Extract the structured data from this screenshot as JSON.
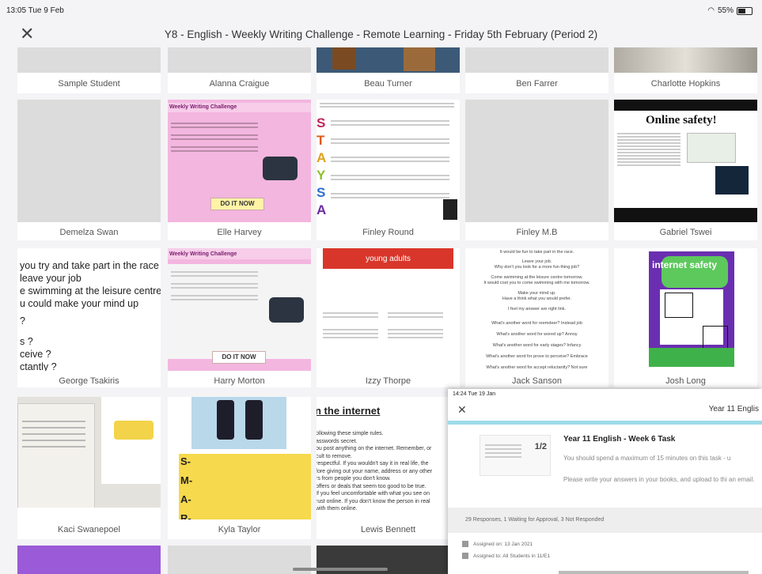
{
  "status": {
    "time_date": "13:05  Tue 9 Feb",
    "battery": "55%"
  },
  "header": {
    "title": "Y8 - English - Weekly Writing Challenge - Remote Learning - Friday 5th February (Period 2)"
  },
  "students": {
    "row1": [
      "Sample Student",
      "Alanna Craigue",
      "Beau Turner",
      "Ben Farrer",
      "Charlotte Hopkins"
    ],
    "row2": [
      "Demelza Swan",
      "Elle Harvey",
      "Finley Round",
      "Finley M.B",
      "Gabriel Tswei"
    ],
    "row3": [
      "George Tsakiris",
      "Harry Morton",
      "Izzy Thorpe",
      "Jack Sanson",
      "Josh Long"
    ],
    "row4": [
      "Kaci Swanepoel",
      "Kyla Taylor",
      "Lewis Bennett"
    ]
  },
  "thumbs": {
    "wwc_title": "Weekly Writing Challenge",
    "do_it_now": "DO IT NOW",
    "online_safety": "Online safety!",
    "internet_safety": "internet safety",
    "young_adults": "young adults",
    "the_internet": "n the internet",
    "smart": [
      "S",
      "T",
      "A",
      "Y",
      "S",
      "A"
    ],
    "smart2": [
      "S-",
      "M-",
      "A-",
      "R-"
    ],
    "george_lines": [
      "you try and take part in the race",
      "leave your job",
      "e swimming at the leisure centre",
      "u could make your mind up",
      "?",
      "s ?",
      "ceive ?",
      "ctantly ?"
    ],
    "jack_lines": [
      "It would be fun to take part in the race.",
      "Leave your job.",
      "Why don't you look for a more fun thing job?",
      "Come swimming at the leisure centre tomorrow.",
      "It would cost you to come swimming with me tomorrow.",
      "Make your mind up.",
      "Have a think what you would prefer.",
      "I feel my answer are right link.",
      "What's another word for reemdeer? Instead job",
      "What's another word for wored up? Annoy",
      "What's another word for early stages? Infancy",
      "What's another word for prove to perceive? Embrace",
      "What's another word for accept reluctantly? Not sure"
    ],
    "lewis_lines": [
      "ollowing these simple rules.",
      "asswords secret.",
      "ou post anything on the internet. Remember, or",
      "cult to remove.",
      "respectful. If you wouldn't say it in real life, the",
      "fore giving out your name, address or any other",
      "rs from people you don't know.",
      "offers or deals that seem too good to be true.",
      "If you feel uncomfortable with what you see on",
      "rust online. If you don't know the person in real",
      "with them online."
    ]
  },
  "overlay": {
    "time": "14:24  Tue 19 Jan",
    "course": "Year 11 Englis",
    "pages": "1/2",
    "task_title": "Year 11 English - Week 6 Task",
    "desc1": "You should spend a maximum of 15 minutes on this task - u",
    "desc2": "Please write your answers in your books, and upload to thi an email.",
    "stats": "29 Responses, 1 Waiting for Approval, 3 Not Responded",
    "assigned_on": "Assigned on: 13 Jan 2021",
    "assigned_to": "Assigned to: All Students in 11/E1"
  }
}
